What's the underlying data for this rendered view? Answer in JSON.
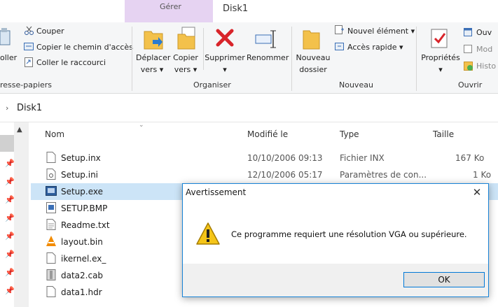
{
  "window": {
    "manage_tab": "Gérer",
    "title": "Disk1"
  },
  "ribbon": {
    "clipboard": {
      "paste_label": "oller",
      "cut_label": "Couper",
      "copy_path_label": "Copier le chemin d'accès",
      "paste_shortcut_label": "Coller le raccourci",
      "group_label": "resse-papiers"
    },
    "organize": {
      "move_label": "Déplacer",
      "move_label2": "vers",
      "copy_label": "Copier",
      "copy_label2": "vers",
      "delete_label": "Supprimer",
      "rename_label": "Renommer",
      "group_label": "Organiser"
    },
    "new": {
      "new_folder_label": "Nouveau",
      "new_folder_label2": "dossier",
      "new_item_label": "Nouvel élément",
      "easy_access_label": "Accès rapide",
      "group_label": "Nouveau"
    },
    "open": {
      "properties_label": "Propriétés",
      "open_label": "Ouv",
      "modify_label": "Mod",
      "history_label": "Histo",
      "group_label": "Ouvrir"
    }
  },
  "address": {
    "path": "Disk1"
  },
  "columns": {
    "name": "Nom",
    "modified": "Modifié le",
    "type": "Type",
    "size": "Taille"
  },
  "files": [
    {
      "name": "Setup.inx",
      "modified": "10/10/2006 09:13",
      "type": "Fichier INX",
      "size": "167 Ko"
    },
    {
      "name": "Setup.ini",
      "modified": "12/10/2006 05:17",
      "type": "Paramètres de con...",
      "size": "1 Ko"
    },
    {
      "name": "Setup.exe",
      "modified": "",
      "type": "",
      "size": ""
    },
    {
      "name": "SETUP.BMP",
      "modified": "",
      "type": "",
      "size": ""
    },
    {
      "name": "Readme.txt",
      "modified": "",
      "type": "",
      "size": ""
    },
    {
      "name": "layout.bin",
      "modified": "",
      "type": "",
      "size": ""
    },
    {
      "name": "ikernel.ex_",
      "modified": "",
      "type": "",
      "size": ""
    },
    {
      "name": "data2.cab",
      "modified": "",
      "type": "",
      "size": ""
    },
    {
      "name": "data1.hdr",
      "modified": "",
      "type": "",
      "size": ""
    }
  ],
  "dialog": {
    "title": "Avertissement",
    "close": "✕",
    "message": "Ce programme requiert une résolution VGA ou supérieure.",
    "ok_label": "OK"
  },
  "colors": {
    "manage_tab": "#e6d3f2",
    "selected_row": "#cce4f7",
    "dialog_border": "#1883d7",
    "warning": "#f5c518"
  }
}
